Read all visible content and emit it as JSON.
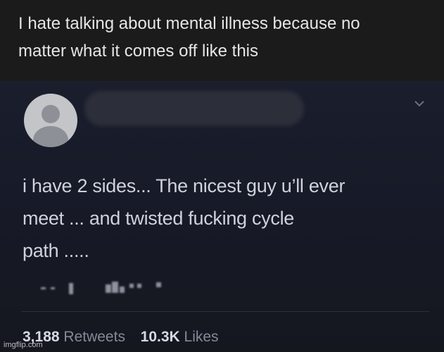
{
  "caption": {
    "line1": "I hate talking about mental illness because no",
    "line2": "matter what it comes off like this"
  },
  "tweet": {
    "text_line1": "i have 2 sides... The nicest guy u’ll ever",
    "text_line2": "meet ... and twisted fucking cycle",
    "text_line3": "path .....",
    "retweets_count": "3,188",
    "retweets_label": "Retweets",
    "likes_count": "10.3K",
    "likes_label": "Likes"
  },
  "watermark": "imgflip.com",
  "icons": {
    "avatar": "default-avatar-icon",
    "menu": "chevron-down-icon"
  },
  "colors": {
    "caption_bg": "#1b1b1b",
    "tweet_bg": "#181b28",
    "text": "#cfd2dc",
    "muted": "#858a97"
  }
}
